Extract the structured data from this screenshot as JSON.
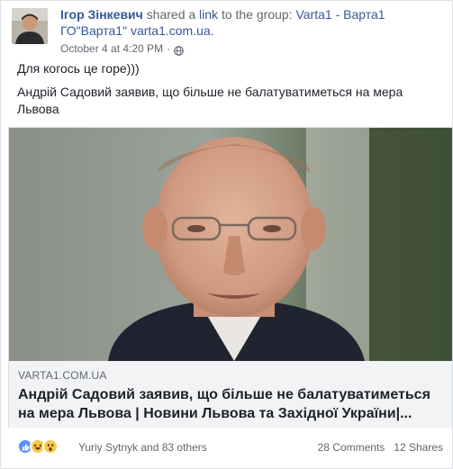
{
  "post": {
    "author": "Ігор Зінкевич",
    "shared_a": "shared a",
    "link_word": "link",
    "to_the_group": "to the group:",
    "group": "Varta1 - Варта1 ГО\"Варта1\" varta1.com.ua.",
    "timestamp": "October 4 at 4:20 PM",
    "body_line1": "Для когось це горе)))",
    "body_line2": "Андрій Садовий заявив, що більше не балатуватиметься на мера Львова"
  },
  "preview": {
    "domain": "VARTA1.COM.UA",
    "title": "Андрій Садовий заявив, що більше не балатуватиметься на мера Львова | Новини Львова та Західної України|..."
  },
  "footer": {
    "reaction_names": "Yuriy Sytnyk and 83 others",
    "comments": "28 Comments",
    "shares": "12 Shares"
  },
  "colors": {
    "link": "#365899",
    "meta": "#616770",
    "like": "#5890ff",
    "emoji": "#f7c94b"
  },
  "icons": [
    "globe-icon",
    "like-reaction-icon",
    "haha-reaction-icon",
    "wow-reaction-icon"
  ]
}
